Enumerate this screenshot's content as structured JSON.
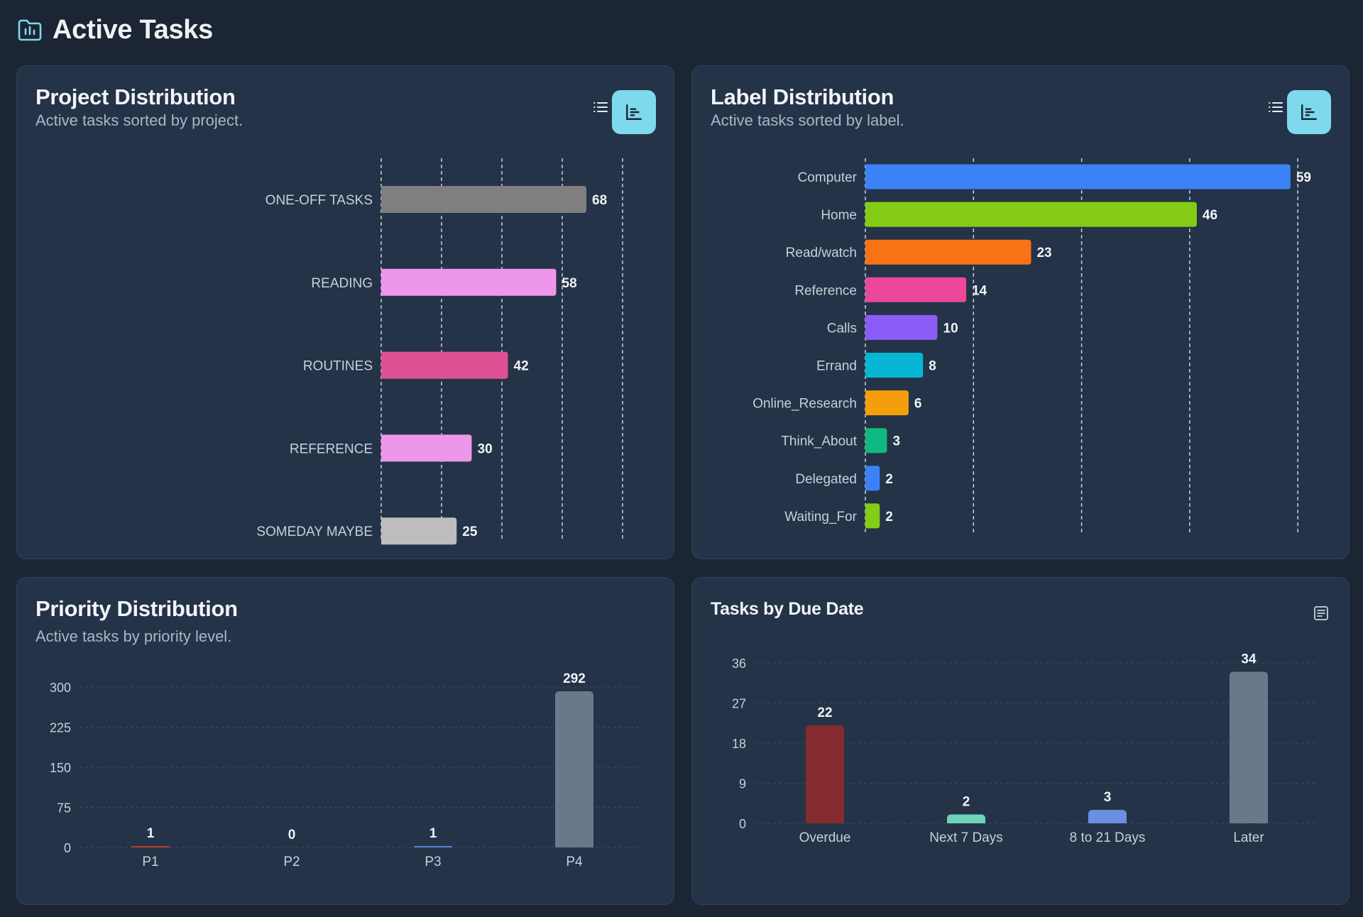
{
  "page": {
    "title": "Active Tasks",
    "icon": "folder-chart-icon"
  },
  "colors": {
    "background": "#1c2533",
    "card": "#243347",
    "accent": "#7fd9ec",
    "text": "#e8edf3",
    "muted": "#aab6c5"
  },
  "cards": {
    "project": {
      "title": "Project Distribution",
      "subtitle": "Active tasks sorted by project.",
      "list_icon": "list-icon",
      "chart_icon": "bar-chart-icon"
    },
    "label": {
      "title": "Label Distribution",
      "subtitle": "Active tasks sorted by label.",
      "list_icon": "list-icon",
      "chart_icon": "bar-chart-icon"
    },
    "priority": {
      "title": "Priority Distribution",
      "subtitle": "Active tasks by priority level."
    },
    "due": {
      "title": "Tasks by Due Date",
      "doc_icon": "document-icon"
    }
  },
  "chart_data": [
    {
      "id": "project",
      "type": "bar",
      "orientation": "horizontal",
      "categories": [
        "ONE-OFF TASKS",
        "READING",
        "ROUTINES",
        "REFERENCE",
        "SOMEDAY MAYBE"
      ],
      "values": [
        68,
        58,
        42,
        30,
        25
      ],
      "colors": [
        "#7f7f7f",
        "#ee96ea",
        "#e05094",
        "#ee96ea",
        "#bdbdbd"
      ],
      "xlim": [
        0,
        80
      ],
      "grid": "vertical dashed"
    },
    {
      "id": "label",
      "type": "bar",
      "orientation": "horizontal",
      "categories": [
        "Computer",
        "Home",
        "Read/watch",
        "Reference",
        "Calls",
        "Errand",
        "Online_Research",
        "Think_About",
        "Delegated",
        "Waiting_For"
      ],
      "values": [
        59,
        46,
        23,
        14,
        10,
        8,
        6,
        3,
        2,
        2
      ],
      "colors": [
        "#3b82f6",
        "#84cc16",
        "#f97316",
        "#ec4899",
        "#8b5cf6",
        "#06b6d4",
        "#f59e0b",
        "#10b981",
        "#3b82f6",
        "#84cc16"
      ],
      "xlim": [
        0,
        60
      ],
      "grid": "vertical dashed"
    },
    {
      "id": "priority",
      "type": "bar",
      "orientation": "vertical",
      "categories": [
        "P1",
        "P2",
        "P3",
        "P4"
      ],
      "values": [
        1,
        0,
        1,
        292
      ],
      "colors": [
        "#c0392b",
        "#e0a030",
        "#5b7fdb",
        "#687a8a"
      ],
      "ylim": [
        0,
        300
      ],
      "yticks": [
        0,
        75,
        150,
        225,
        300
      ],
      "grid": "horizontal dashed"
    },
    {
      "id": "due",
      "type": "bar",
      "orientation": "vertical",
      "categories": [
        "Overdue",
        "Next 7 Days",
        "8 to 21 Days",
        "Later"
      ],
      "values": [
        22,
        2,
        3,
        34
      ],
      "colors": [
        "#852a2e",
        "#6ed3b8",
        "#6a8fe0",
        "#687a8a"
      ],
      "ylim": [
        0,
        36
      ],
      "yticks": [
        0,
        9,
        18,
        27,
        36
      ],
      "grid": "horizontal dashed"
    }
  ]
}
